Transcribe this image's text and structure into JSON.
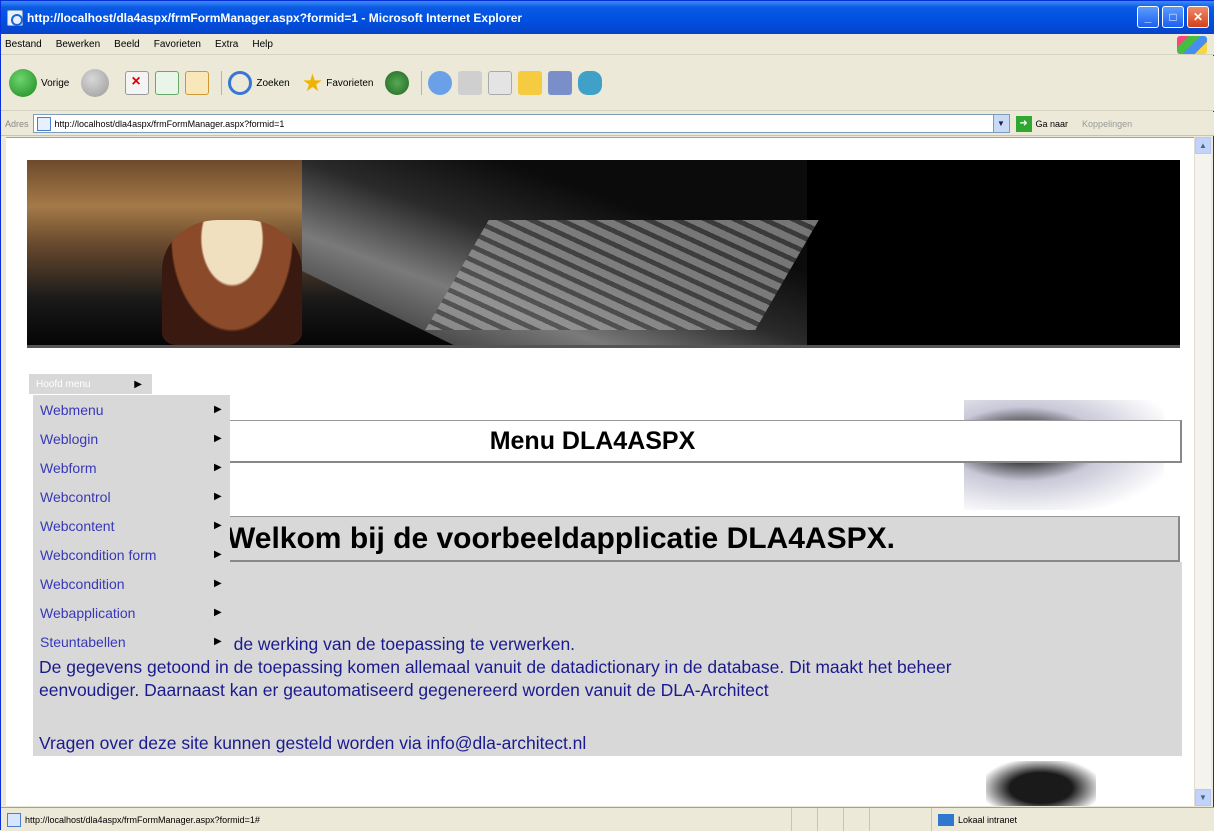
{
  "window": {
    "title": "http://localhost/dla4aspx/frmFormManager.aspx?formid=1 - Microsoft Internet Explorer",
    "min_label": "_",
    "max_label": "□",
    "close_label": "✕"
  },
  "menubar": {
    "items": [
      "Bestand",
      "Bewerken",
      "Beeld",
      "Favorieten",
      "Extra",
      "Help"
    ]
  },
  "toolbar": {
    "back_label": "Vorige",
    "search_label": "Zoeken",
    "favorites_label": "Favorieten"
  },
  "address": {
    "label": "Adres",
    "url": "http://localhost/dla4aspx/frmFormManager.aspx?formid=1",
    "go_label": "Ga naar",
    "links_label": "Koppelingen"
  },
  "page": {
    "menu_tab_label": "Hoofd menu",
    "dropdown": [
      {
        "label": "Webmenu"
      },
      {
        "label": "Weblogin"
      },
      {
        "label": "Webform"
      },
      {
        "label": "Webcontrol"
      },
      {
        "label": "Webcontent"
      },
      {
        "label": "Webcondition form"
      },
      {
        "label": "Webcondition"
      },
      {
        "label": "Webapplication"
      },
      {
        "label": "Steuntabellen"
      }
    ],
    "title": "Menu DLA4ASPX",
    "welcome": "Welkom bij de voorbeeldapplicatie DLA4ASPX.",
    "line1": "n de werking van de toepassing te verwerken.",
    "line2": "De gegevens getoond in de toepassing komen allemaal vanuit de datadictionary in de database. Dit maakt het beheer",
    "line3": "eenvoudiger. Daarnaast kan er geautomatiseerd gegenereerd worden vanuit de DLA-Architect",
    "line4": "Vragen over deze site kunnen gesteld worden via info@dla-architect.nl"
  },
  "status": {
    "url": "http://localhost/dla4aspx/frmFormManager.aspx?formid=1#",
    "zone": "Lokaal intranet"
  },
  "colors": {
    "titlebar": "#0a5ae6",
    "menu_bg": "#d8d8d8",
    "link_text": "#3838b8",
    "body_text": "#1a1a8e"
  }
}
